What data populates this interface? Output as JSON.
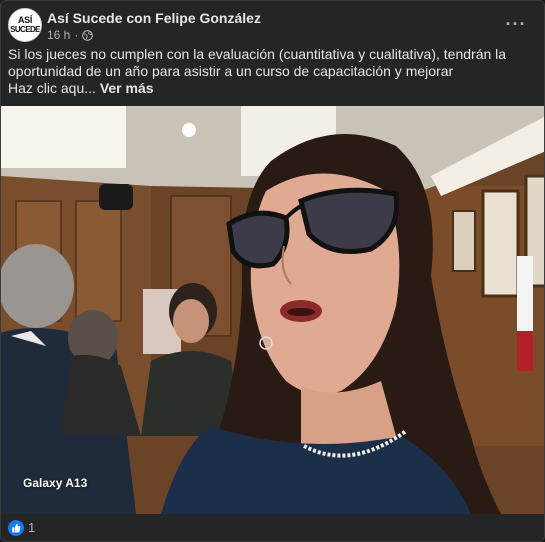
{
  "post": {
    "author": "Así Sucede con Felipe González",
    "avatar_text_line1": "ASÍ",
    "avatar_text_line2": "SUCEDE",
    "time": "16 h",
    "audience_icon": "globe-icon",
    "more_icon": "more-options-icon",
    "more_label": "···",
    "text": "Si los jueces no cumplen con la evaluación (cuantitativa y cualitativa), tendrán la oportunidad de un año para asistir a un curso de capacitación y mejorar",
    "text_line2": "Haz clic aqu...",
    "see_more": "Ver más"
  },
  "media": {
    "watermark": "Galaxy A13",
    "type": "video-frame"
  },
  "reactions": {
    "icon": "like-icon",
    "count": "1"
  },
  "colors": {
    "card_bg": "#242526",
    "text": "#e4e6eb",
    "secondary_text": "#b0b3b8",
    "like_blue": "#1877f2"
  }
}
